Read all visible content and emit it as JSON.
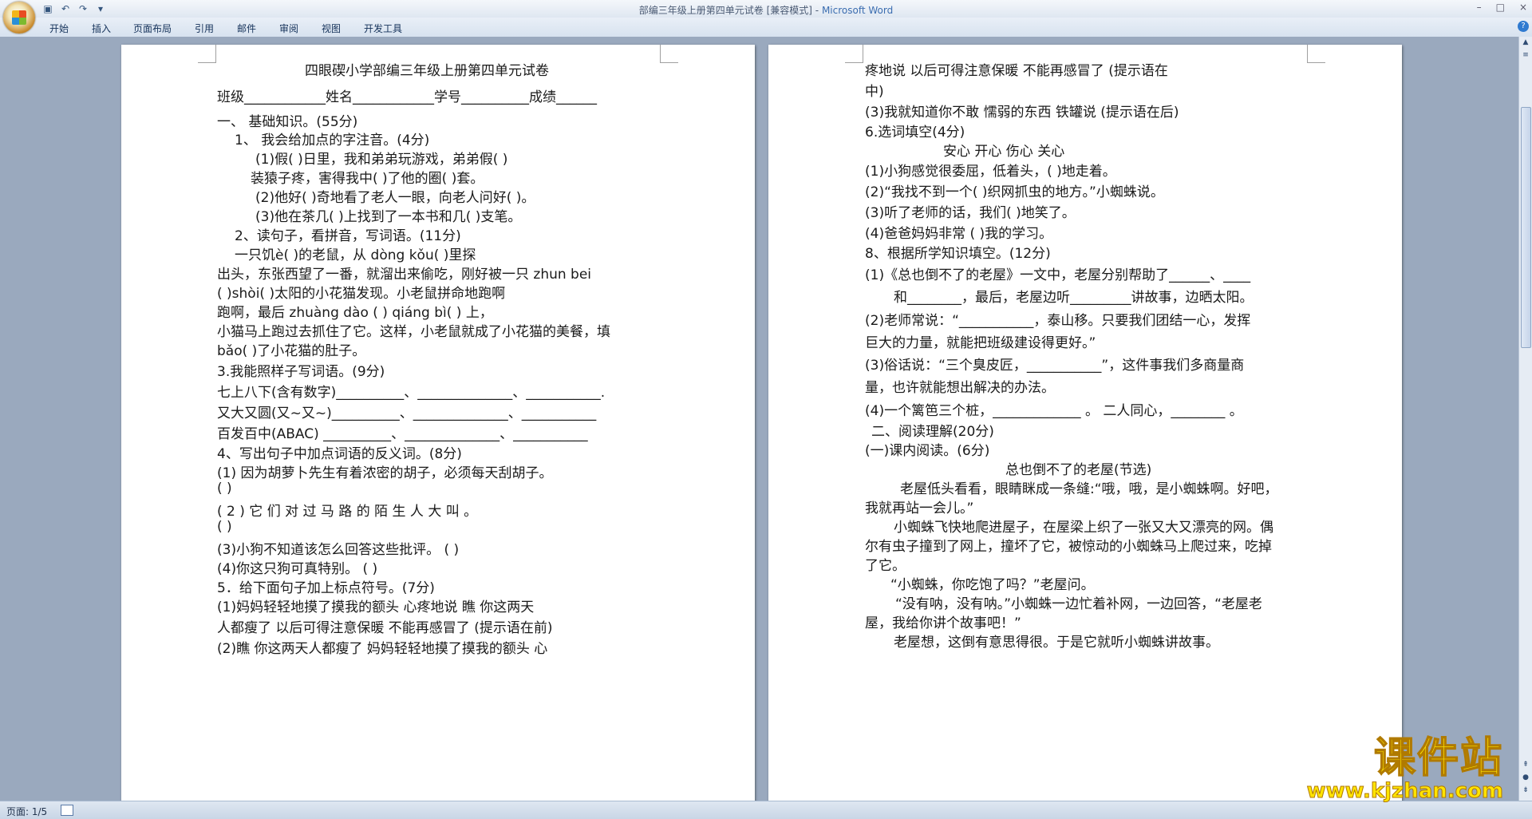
{
  "window": {
    "title": "部编三年级上册第四单元试卷 [兼容模式]",
    "app_name": "Microsoft Word",
    "controls": [
      "–",
      "□",
      "×"
    ]
  },
  "quick_access": [
    "save-icon",
    "undo-icon",
    "redo-icon",
    "customize-icon"
  ],
  "ribbon_tabs": [
    "开始",
    "插入",
    "页面布局",
    "引用",
    "邮件",
    "审阅",
    "视图",
    "开发工具"
  ],
  "left_page": {
    "title": "四眼碶小学部编三年级上册第四单元试卷",
    "lines": [
      "班级____________姓名____________学号__________成绩______",
      "一、   基础知识。(55分)",
      "1、   我会给加点的字注音。(4分)",
      "(1)假(      )日里，我和弟弟玩游戏，弟弟假(      )",
      "装猿子疼，害得我中(      )了他的圈(      )套。",
      "(2)他好(      )奇地看了老人一眼，向老人问好(      )。",
      "(3)他在茶几(      )上找到了一本书和几(      )支笔。",
      "2、读句子，看拼音，写词语。(11分)",
      "一只饥è(        )的老鼠，从 dòng kǒu(        )里探",
      "出头，东张西望了一番，就溜出来偷吃，刚好被一只 zhun  bei",
      "(        )shòi(      )太阳的小花猫发现。小老鼠拼命地跑啊",
      "跑啊，最后 zhuàng dào (        ) qiáng bì(        ) 上，",
      "小猫马上跑过去抓住了它。这样，小老鼠就成了小花猫的美餐，填",
      "bǎo(      )了小花猫的肚子。",
      "3.我能照样子写词语。(9分)",
      "七上八下(含有数字)__________、______________、___________.",
      "又大又圆(又~又~)__________、______________、___________",
      "百发百中(ABAC)   __________、______________、___________",
      "4、写出句子中加点词语的反义词。(8分)",
      "(1) 因为胡萝卜先生有着浓密的胡子，必须每天刮胡子。",
      "(      )",
      "(  2  )  它  们  对  过  马  路  的  陌  生  人  大  叫  。",
      "(      )",
      "(3)小狗不知道该怎么回答这些批评。                 (      )",
      "(4)你这只狗可真特别。                             (      )",
      "5．给下面句子加上标点符号。(7分)",
      "(1)妈妈轻轻地摸了摸我的额头      心疼地说     瞧   你这两天",
      "人都瘦了     以后可得注意保暖     不能再感冒了      (提示语在前)",
      "(2)瞧   你这两天人都瘦了     妈妈轻轻地摸了摸我的额头      心"
    ]
  },
  "right_page": {
    "lines": [
      "疼地说      以后可得注意保暖      不能再感冒了         (提示语在",
      "中)",
      "(3)我就知道你不敢     懦弱的东西     铁罐说          (提示语在后)",
      "6.选词填空(4分)",
      "安心           开心           伤心           关心",
      "(1)小狗感觉很委屈，低着头，(        )地走着。",
      "(2)“我找不到一个(        )织网抓虫的地方。”小蜘蛛说。",
      "(3)听了老师的话，我们(        )地笑了。",
      "(4)爸爸妈妈非常 (         )我的学习。",
      "8、根据所学知识填空。(12分)",
      "(1)《总也倒不了的老屋》一文中，老屋分别帮助了______、____",
      "和________，最后，老屋边听_________讲故事，边晒太阳。",
      "(2)老师常说：“___________，泰山移。只要我们团结一心，发挥",
      "巨大的力量，就能把班级建设得更好。”",
      "(3)俗话说：“三个臭皮匠，___________”，这件事我们多商量商",
      "量，也许就能想出解决的办法。",
      "(4)一个篱笆三个桩，_____________ 。  二人同心，________ 。",
      "二、阅读理解(20分)",
      "(一)课内阅读。(6分)",
      "总也倒不了的老屋(节选)",
      "老屋低头看看，眼睛眯成一条缝:“哦，哦，是小蜘蛛啊。好吧，",
      "我就再站一会儿。”",
      "小蜘蛛飞快地爬进屋子，在屋梁上织了一张又大又漂亮的网。偶",
      "尔有虫子撞到了网上，撞坏了它，被惊动的小蜘蛛马上爬过来，吃掉",
      "了它。",
      "“小蜘蛛，你吃饱了吗？”老屋问。",
      "“没有呐，没有呐。”小蜘蛛一边忙着补网，一边回答，“老屋老",
      "屋，我给你讲个故事吧！”",
      "老屋想，这倒有意思得很。于是它就听小蜘蛛讲故事。"
    ]
  },
  "status_bar": {
    "page_info": "页面: 1/5"
  },
  "watermark": {
    "text": "课件站",
    "url": "www.kjzhan.com"
  }
}
